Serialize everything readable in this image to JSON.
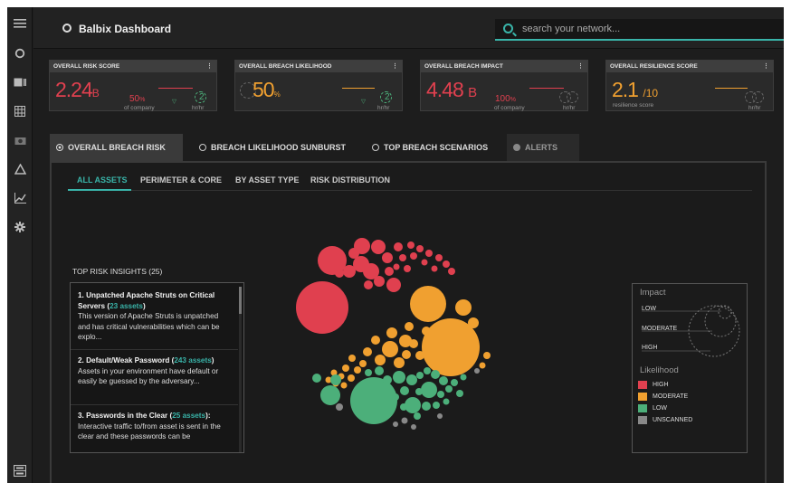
{
  "app": {
    "title": "Balbix Dashboard"
  },
  "search": {
    "placeholder": "search your network..."
  },
  "sidebar": {
    "icons": [
      "menu-icon",
      "ring-icon",
      "id-card-icon",
      "grid-icon",
      "camera-icon",
      "triangle-icon",
      "line-chart-icon",
      "gear-icon",
      "server-icon"
    ]
  },
  "kpis": [
    {
      "title": "OVERALL RISK SCORE",
      "value": "2.24",
      "unit": "B",
      "sub": "50",
      "sub_unit": "%",
      "cap": "of company",
      "delta_cap": "hr/hr",
      "delta": "2",
      "color": "#e0404f",
      "delta_color": "#4caf7a"
    },
    {
      "title": "OVERALL BREACH LIKELIHOOD",
      "value": "50",
      "unit": "%",
      "sub": "",
      "sub_unit": "",
      "cap": "",
      "delta_cap": "hr/hr",
      "delta": "2",
      "color": "#f0a030",
      "delta_color": "#4caf7a"
    },
    {
      "title": "OVERALL BREACH IMPACT",
      "value": "4.48",
      "unit": "B",
      "sub": "100",
      "sub_unit": "%",
      "cap": "of company",
      "delta_cap": "hr/hr",
      "delta": "",
      "color": "#e0404f",
      "delta_color": "#888"
    },
    {
      "title": "OVERALL RESILIENCE SCORE",
      "value": "2.1",
      "unit": "/10",
      "sub": "",
      "sub_unit": "",
      "cap": "resilience score",
      "delta_cap": "hr/hr",
      "delta": "",
      "color": "#f0a030",
      "delta_color": "#888"
    }
  ],
  "tabs": [
    {
      "label": "OVERALL BREACH RISK",
      "active": true
    },
    {
      "label": "BREACH LIKELIHOOD SUNBURST",
      "active": false
    },
    {
      "label": "TOP BREACH SCENARIOS",
      "active": false
    },
    {
      "label": "ALERTS",
      "active": false
    }
  ],
  "subtabs": [
    "ALL ASSETS",
    "PERIMETER & CORE",
    "BY ASSET TYPE",
    "RISK DISTRIBUTION"
  ],
  "insights": {
    "title": "TOP RISK INSIGHTS (25)",
    "items": [
      {
        "heading": "1. Unpatched Apache Struts on Critical Servers (",
        "link": "23 assets",
        "heading_end": ")",
        "body": "This version of Apache Struts is unpatched and has critical vulnerabilities which can be explo..."
      },
      {
        "heading": "2. Default/Weak Password (",
        "link": "243 assets",
        "heading_end": ")",
        "body": "Assets in your environment have default or easily be guessed by the adversary..."
      },
      {
        "heading": "3. Passwords in the Clear (",
        "link": "25 assets",
        "heading_end": "):",
        "body": "Interactive traffic to/from asset is sent in the clear and these passwords can be"
      }
    ]
  },
  "legend": {
    "impact_title": "Impact",
    "impact_levels": [
      "LOW",
      "MODERATE",
      "HIGH"
    ],
    "likelihood_title": "Likelihood",
    "likelihood_levels": [
      {
        "label": "HIGH",
        "color": "#e0404f"
      },
      {
        "label": "MODERATE",
        "color": "#f0a030"
      },
      {
        "label": "LOW",
        "color": "#4caf7a"
      },
      {
        "label": "UNSCANNED",
        "color": "#888888"
      }
    ]
  }
}
